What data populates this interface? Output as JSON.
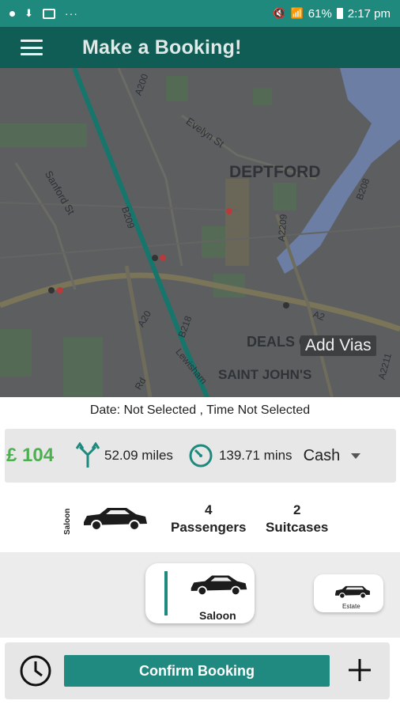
{
  "status_bar": {
    "battery": "61%",
    "time": "2:17 pm"
  },
  "app_bar": {
    "title": "Make a Booking!"
  },
  "map": {
    "labels": {
      "a200": "A200",
      "evelyn_st": "Evelyn St",
      "deptford": "DEPTFORD",
      "sanford_st": "Sanford St",
      "b208": "B208",
      "a2209": "A2209",
      "b209": "B209",
      "a20_top": "A20",
      "b218": "B218",
      "a20": "A20",
      "a2": "A2",
      "deals_gateway": "DEALS GATEWAY",
      "saint_johns": "SAINT JOHN'S",
      "lewisham": "Lewisham",
      "rd": "Rd",
      "a2211": "A2211"
    },
    "add_vias_label": "Add Vias",
    "route_color": "#17766c"
  },
  "booking": {
    "date_time_text": "Date: Not Selected , Time  Not Selected",
    "price": "£ 104",
    "distance": "52.09 miles",
    "duration": "139.71 mins",
    "payment_method": "Cash"
  },
  "vehicle_info": {
    "type": "Saloon",
    "passengers_count": "4",
    "passengers_label": "Passengers",
    "suitcases_count": "2",
    "suitcases_label": "Suitcases"
  },
  "vehicle_options": [
    {
      "label": "Saloon",
      "selected": true
    },
    {
      "label": "Estate",
      "selected": false
    }
  ],
  "actions": {
    "confirm_label": "Confirm Booking"
  },
  "colors": {
    "status_bar": "#20897d",
    "app_bar": "#0f5d54",
    "accent": "#218a80",
    "price": "#4caf50"
  }
}
